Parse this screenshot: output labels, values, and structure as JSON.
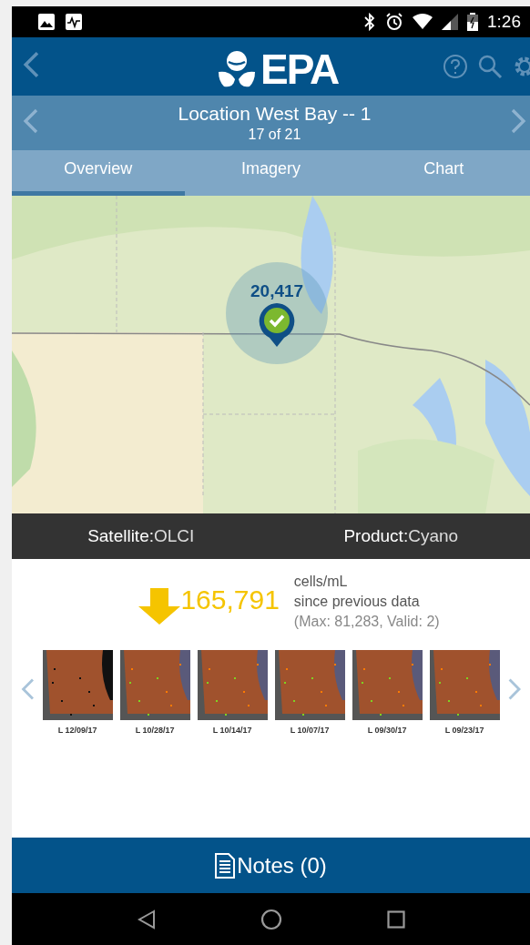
{
  "status_bar": {
    "time": "1:26"
  },
  "header": {
    "logo_text": "EPA"
  },
  "location": {
    "title": "Location West Bay -- 1",
    "position": "17 of 21"
  },
  "tabs": [
    {
      "label": "Overview",
      "selected": true
    },
    {
      "label": "Imagery",
      "selected": false
    },
    {
      "label": "Chart",
      "selected": false
    }
  ],
  "map": {
    "marker": {
      "count": "20,417",
      "checked": true
    }
  },
  "info_bar": [
    {
      "label": "Satellite:",
      "value": "OLCI"
    },
    {
      "label": "Product:",
      "value": "Cyano"
    }
  ],
  "change": {
    "decreased": true,
    "value": "165,791",
    "unit": "cells/mL",
    "note": "since previous data",
    "detail": "(Max: 81,283, Valid: 2)"
  },
  "thumbnails": [
    {
      "date": "L 12/09/17",
      "kind": "dark"
    },
    {
      "date": "L 10/28/17",
      "kind": "color"
    },
    {
      "date": "L 10/14/17",
      "kind": "color"
    },
    {
      "date": "L 10/07/17",
      "kind": "color"
    },
    {
      "date": "L 09/30/17",
      "kind": "color"
    },
    {
      "date": "L 09/23/17",
      "kind": "color"
    }
  ],
  "notes_button": {
    "label": "Notes (0)"
  }
}
